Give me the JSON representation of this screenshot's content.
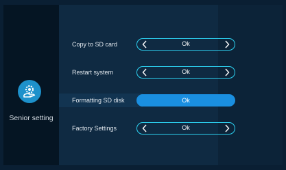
{
  "sidebar": {
    "icon": "gear-hand-icon",
    "label": "Senior setting"
  },
  "settings": [
    {
      "label": "Copy to SD card",
      "value": "Ok",
      "selected": false
    },
    {
      "label": "Restart system",
      "value": "Ok",
      "selected": false
    },
    {
      "label": "Formatting SD disk",
      "value": "Ok",
      "selected": true
    },
    {
      "label": "Factory Settings",
      "value": "Ok",
      "selected": false
    }
  ],
  "colors": {
    "accent": "#2dd4f4",
    "selected_fill": "#1a8fe0",
    "icon_bg": "#1d91cb"
  }
}
